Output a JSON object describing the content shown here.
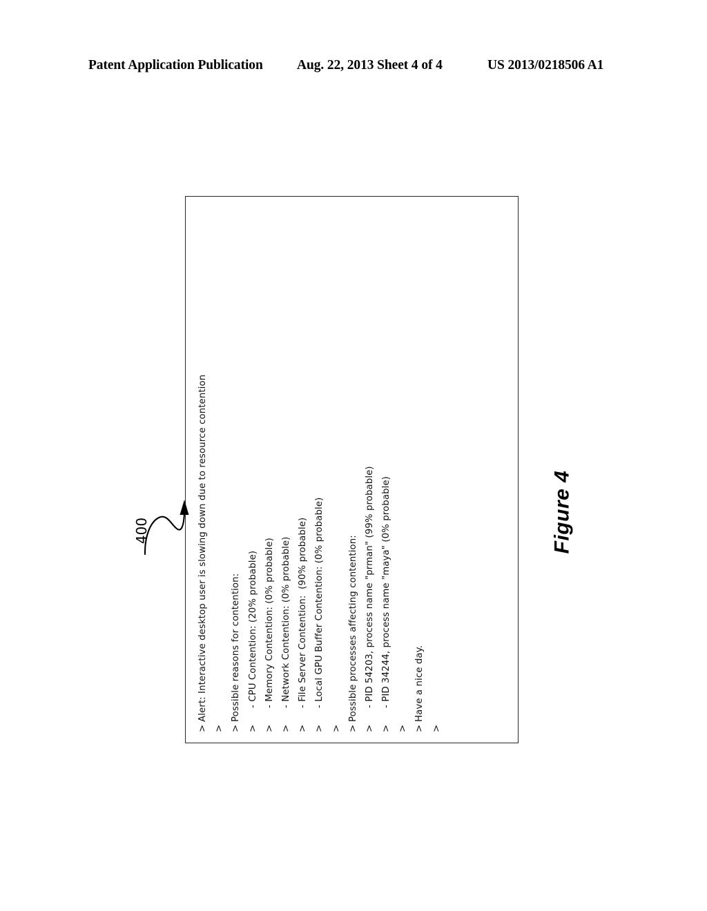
{
  "page_header": {
    "left": "Patent Application Publication",
    "middle": "Aug. 22, 2013  Sheet 4 of 4",
    "right": "US 2013/0218506 A1"
  },
  "figure": {
    "reference_numeral": "400",
    "caption": "Figure 4",
    "leader_icon": "curved-leader-arrow-icon"
  },
  "console": {
    "prompt_symbol": ">",
    "lines": [
      {
        "prompt": ">",
        "text": "Alert: Interactive desktop user is slowing down due to resource contention",
        "style": "normal"
      },
      {
        "prompt": ">",
        "text": "",
        "style": "normal"
      },
      {
        "prompt": ">",
        "text": "Possible reasons for contention:",
        "style": "normal"
      },
      {
        "prompt": ">",
        "text": "- CPU Contention: (20% probable)",
        "style": "bullet"
      },
      {
        "prompt": ">",
        "text": "- Memory Contention: (0% probable)",
        "style": "bullet"
      },
      {
        "prompt": ">",
        "text": "- Network Contention: (0% probable)",
        "style": "bullet"
      },
      {
        "prompt": ">",
        "text": "- File Server Contention:  (90% probable)",
        "style": "bullet"
      },
      {
        "prompt": ">",
        "text": "- Local GPU Buffer Contention: (0% probable)",
        "style": "bullet"
      },
      {
        "prompt": ">",
        "text": "",
        "style": "normal"
      },
      {
        "prompt": ">",
        "text": "Possible processes affecting contention:",
        "style": "normal"
      },
      {
        "prompt": ">",
        "text": "- PID 54203, process name \"prman\" (99% probable)",
        "style": "bullet"
      },
      {
        "prompt": ">",
        "text": "- PID 34244, process name \"maya\" (0% probable)",
        "style": "bullet"
      },
      {
        "prompt": ">",
        "text": "",
        "style": "normal"
      },
      {
        "prompt": ">",
        "text": "Have a nice day.",
        "style": "normal"
      },
      {
        "prompt": ">",
        "text": "",
        "style": "normal"
      }
    ]
  }
}
